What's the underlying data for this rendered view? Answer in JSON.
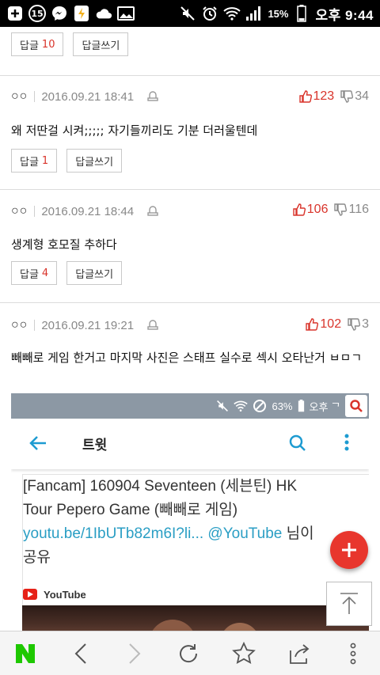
{
  "status_bar": {
    "notification_count": "15",
    "battery_percent": "15%",
    "time": "오후 9:44",
    "icons": [
      "plus-box-icon",
      "notification-count-icon",
      "messenger-icon",
      "app-icon",
      "cloud-icon",
      "gallery-icon",
      "mute-icon",
      "alarm-icon",
      "wifi-icon",
      "signal-icon",
      "battery-icon"
    ]
  },
  "comments": [
    {
      "reply_label": "답글",
      "reply_count": "10",
      "write_label": "답글쓰기"
    },
    {
      "nickname": "○○",
      "date": "2016.09.21 18:41",
      "upvotes": "123",
      "downvotes": "34",
      "text": "왜 저딴걸 시켜;;;;; 자기들끼리도 기분 더러울텐데",
      "reply_label": "답글",
      "reply_count": "1",
      "write_label": "답글쓰기"
    },
    {
      "nickname": "○○",
      "date": "2016.09.21 18:44",
      "upvotes": "106",
      "downvotes": "116",
      "text": "생계형 호모질 추하다",
      "reply_label": "답글",
      "reply_count": "4",
      "write_label": "답글쓰기"
    },
    {
      "nickname": "○○",
      "date": "2016.09.21 19:21",
      "upvotes": "102",
      "downvotes": "3",
      "text": "빼빼로 게임 한거고 마지막 사진은 스태프 실수로 섹시 오타난거 ㅂㅁㄱ"
    }
  ],
  "embedded_screenshot": {
    "status": {
      "battery_percent": "63%",
      "time": "오후 ᄀ"
    },
    "toolbar_title": "트윗",
    "tweet": {
      "line1": "[Fancam] 160904 Seventeen (세븐틴) HK",
      "line2": "Tour  Pepero Game (빼빼로 게임)",
      "link1": "youtu.be/1IbUTb82m6I?li...",
      "mention": " @YouTube",
      "line3_tail": " 님이",
      "line4": "공유"
    },
    "youtube_label": "YouTube"
  },
  "bottom_nav": {
    "icons": [
      "naver-home-icon",
      "back-arrow-icon",
      "forward-arrow-icon",
      "refresh-icon",
      "bookmark-star-icon",
      "share-icon",
      "more-menu-icon"
    ]
  },
  "colors": {
    "accent_red": "#d9342b",
    "fab_red": "#e8362d",
    "naver_green": "#1ec800",
    "link_blue": "#2a9ec4"
  }
}
